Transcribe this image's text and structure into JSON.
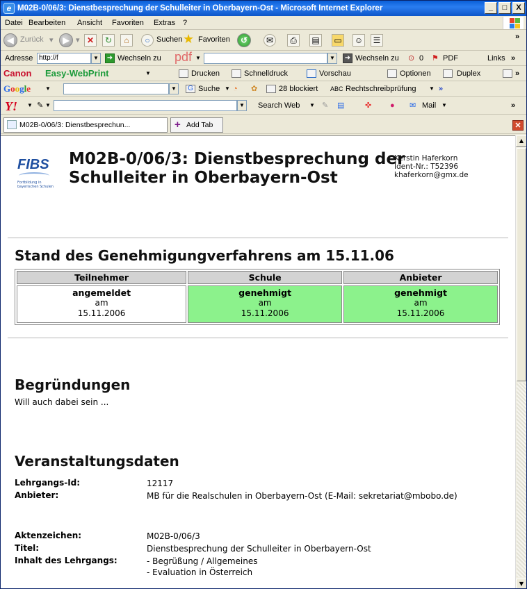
{
  "window": {
    "title": "M02B-0/06/3: Dienstbesprechung der Schulleiter in Oberbayern-Ost - Microsoft Internet Explorer",
    "buttons": [
      "_",
      "□",
      "X"
    ]
  },
  "menu": [
    "Datei",
    "Bearbeiten",
    "Ansicht",
    "Favoriten",
    "Extras",
    "?"
  ],
  "nav": {
    "back": "Zurück",
    "search": "Suchen",
    "favorites": "Favoriten"
  },
  "address": {
    "label": "Adresse",
    "value": "http://f",
    "go": "Wechseln zu",
    "pdf_logo": "pdf",
    "go2": "Wechseln zu",
    "count": "0",
    "pdf": "PDF",
    "links": "Links"
  },
  "canon": {
    "logo": "Canon",
    "product": "Easy-WebPrint",
    "print": "Drucken",
    "quick_print": "Schnelldruck",
    "preview": "Vorschau",
    "options": "Optionen",
    "duplex": "Duplex"
  },
  "google": {
    "logo": "Google",
    "search": "Suche",
    "blocked": "28 blockiert",
    "spell": "Rechtschreibprüfung"
  },
  "yahoo": {
    "logo": "Y!",
    "search_web": "Search Web",
    "mail": "Mail"
  },
  "tabs": {
    "active": "M02B-0/06/3: Dienstbesprechun...",
    "add": "Add Tab"
  },
  "page": {
    "logo": "FIBS",
    "logo_sub": "Fortbildung in bayerischen Schulen",
    "title": "M02B-0/06/3: Dienstbesprechung der Schulleiter in Oberbayern-Ost",
    "contact": {
      "name": "Kerstin Haferkorn",
      "ident": "Ident-Nr.: T52396",
      "email": "khaferkorn@gmx.de"
    },
    "status_heading": "Stand des Genehmigungverfahrens am 15.11.06",
    "status_table": {
      "headers": [
        "Teilnehmer",
        "Schule",
        "Anbieter"
      ],
      "cells": [
        {
          "state": "angemeldet",
          "am": "am",
          "date": "15.11.2006",
          "color": "#ffffff"
        },
        {
          "state": "genehmigt",
          "am": "am",
          "date": "15.11.2006",
          "color": "#8cf28c"
        },
        {
          "state": "genehmigt",
          "am": "am",
          "date": "15.11.2006",
          "color": "#8cf28c"
        }
      ]
    },
    "reasons_heading": "Begründungen",
    "reasons_text": "Will auch dabei sein ...",
    "event_heading": "Veranstaltungsdaten",
    "event": [
      {
        "label": "Lehrgangs-Id:",
        "value": "12117"
      },
      {
        "label": "Anbieter:",
        "value": "MB für die Realschulen in Oberbayern-Ost (E-Mail: sekretariat@mbobo.de)"
      },
      {
        "label": "Aktenzeichen:",
        "value": "M02B-0/06/3"
      },
      {
        "label": "Titel:",
        "value": "Dienstbesprechung der Schulleiter in Oberbayern-Ost"
      },
      {
        "label": "Inhalt des Lehrgangs:",
        "value": "- Begrüßung / Allgemeines"
      },
      {
        "label": "",
        "value": "- Evaluation in Österreich"
      }
    ]
  },
  "icons": [
    "ie-icon",
    "back-icon",
    "forward-icon",
    "stop-icon",
    "refresh-icon",
    "home-icon",
    "search-icon",
    "favorites-star-icon",
    "history-icon",
    "mail-icon",
    "print-icon",
    "edit-icon",
    "folder-icon",
    "messenger-icon",
    "research-icon",
    "go-arrow-icon",
    "pdf-icon",
    "google-icon",
    "yahoo-icon",
    "fibs-logo",
    "scroll-up-icon",
    "scroll-down-icon",
    "close-tab-icon",
    "add-tab-icon"
  ],
  "colors": {
    "approved": "#8cf28c",
    "titlebar": "#0a5fd8",
    "header_cell": "#d3d3d3"
  }
}
